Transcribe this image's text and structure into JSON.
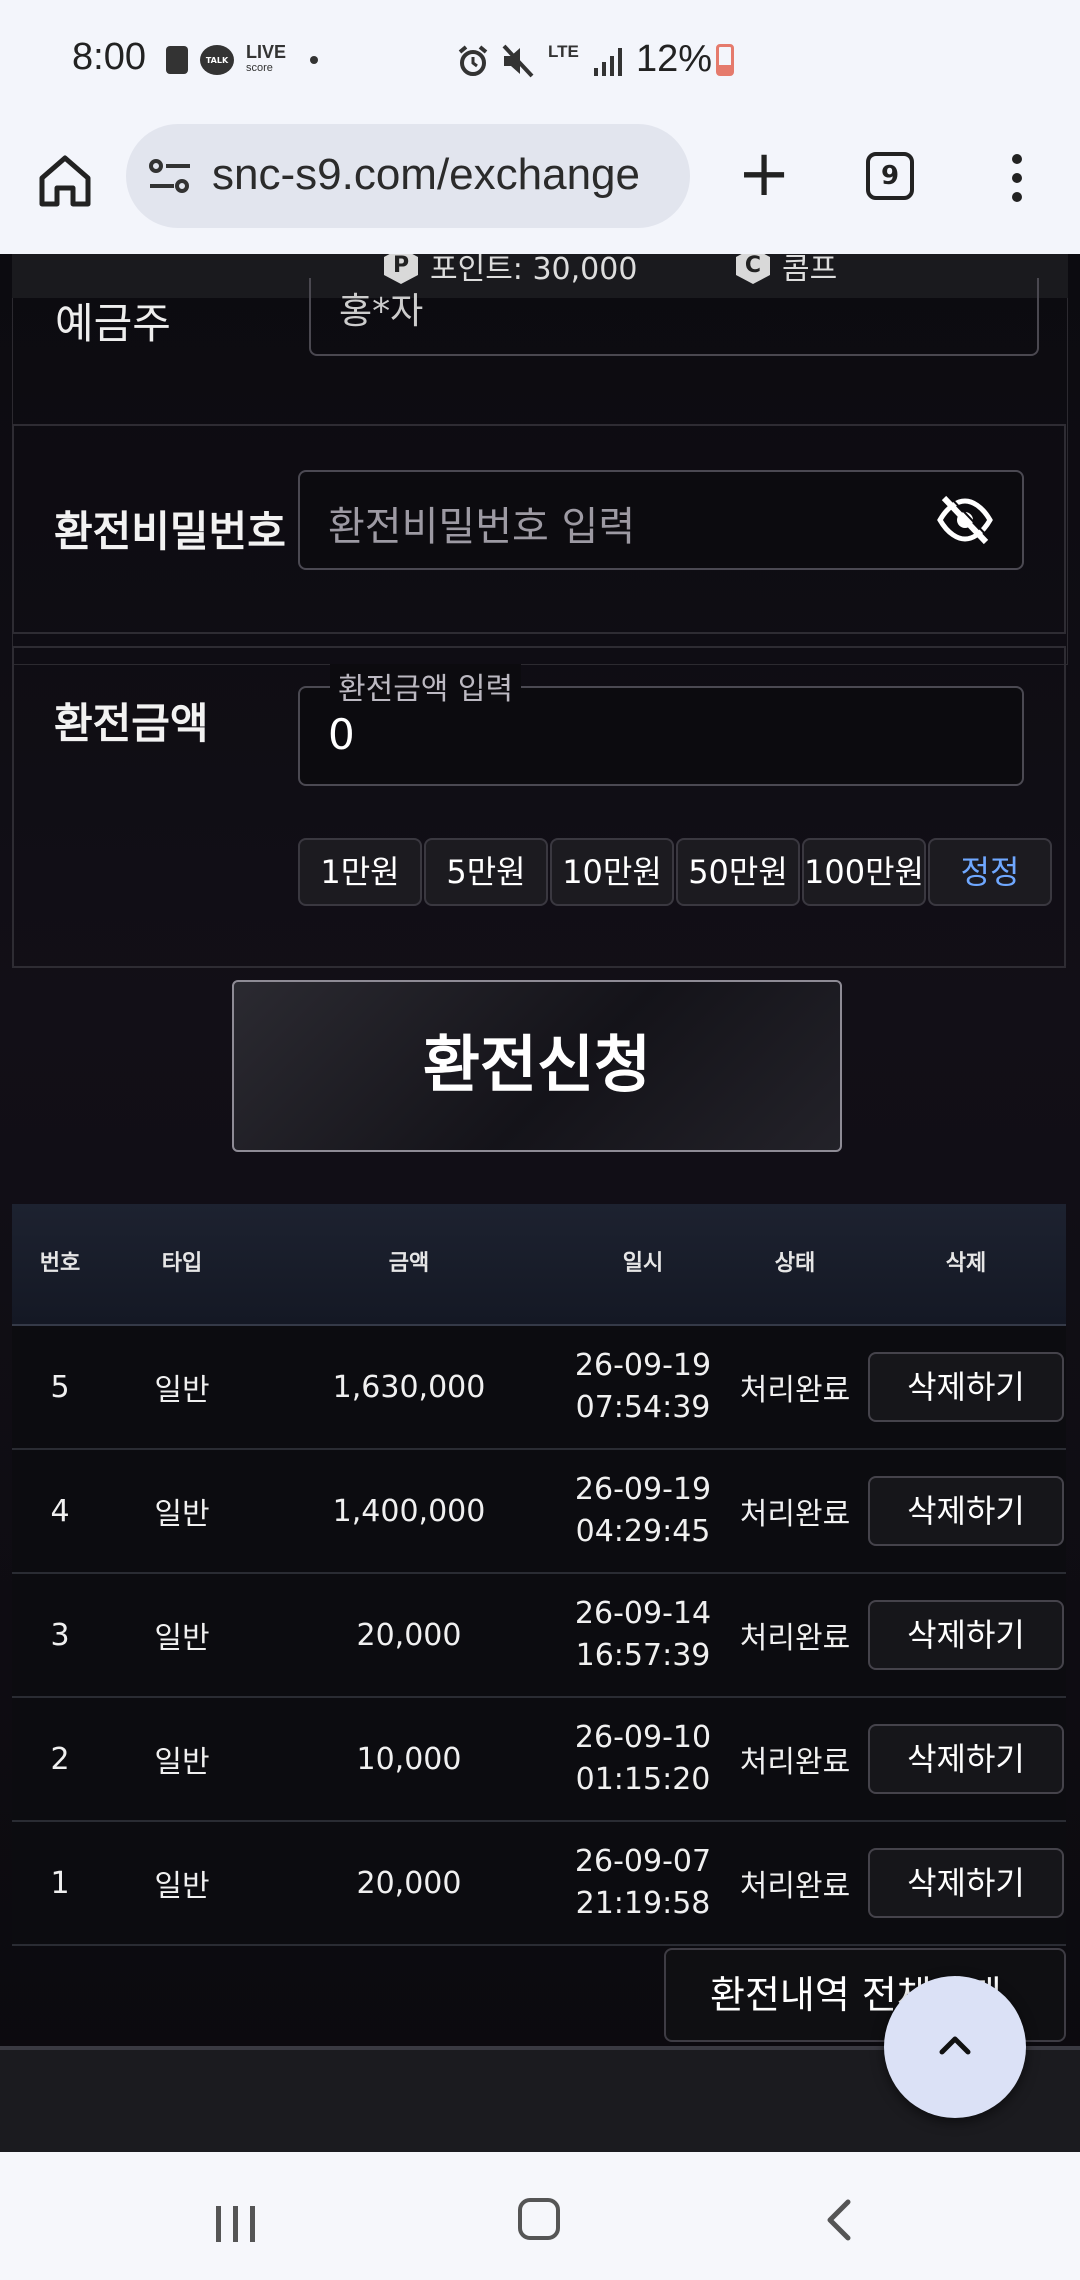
{
  "status_bar": {
    "time": "8:00",
    "left_icons": [
      "alert-icon",
      "talk-icon",
      "livescore-icon",
      "dot-icon"
    ],
    "talk_label": "TALK",
    "live_label": "LIVE",
    "live_sub": "score",
    "network": "LTE",
    "battery_pct": "12%",
    "right_icons": [
      "alarm-icon",
      "mute-icon",
      "lte-icon",
      "signal-icon",
      "battery-icon"
    ]
  },
  "browser": {
    "url": "snc-s9.com/exchange",
    "tab_count": "9"
  },
  "top_info": {
    "points_badge": "P",
    "points_text": "포인트: 30,000",
    "comp_badge": "C",
    "comp_text": "콤프"
  },
  "partial_row": {
    "label": "예금주",
    "value": "홍*자"
  },
  "password_row": {
    "label": "환전비밀번호",
    "placeholder": "환전비밀번호 입력"
  },
  "amount_row": {
    "label": "환전금액",
    "legend": "환전금액 입력",
    "value": "0",
    "chips": [
      "1만원",
      "5만원",
      "10만원",
      "50만원",
      "100만원"
    ],
    "reset_label": "정정"
  },
  "submit_label": "환전신청",
  "table": {
    "headers": [
      "번호",
      "타입",
      "금액",
      "일시",
      "상태",
      "삭제"
    ],
    "rows": [
      {
        "no": "5",
        "type": "일반",
        "amount": "1,630,000",
        "date": "26-09-19",
        "time": "07:54:39",
        "status": "처리완료",
        "action": "삭제하기"
      },
      {
        "no": "4",
        "type": "일반",
        "amount": "1,400,000",
        "date": "26-09-19",
        "time": "04:29:45",
        "status": "처리완료",
        "action": "삭제하기"
      },
      {
        "no": "3",
        "type": "일반",
        "amount": "20,000",
        "date": "26-09-14",
        "time": "16:57:39",
        "status": "처리완료",
        "action": "삭제하기"
      },
      {
        "no": "2",
        "type": "일반",
        "amount": "10,000",
        "date": "26-09-10",
        "time": "01:15:20",
        "status": "처리완료",
        "action": "삭제하기"
      },
      {
        "no": "1",
        "type": "일반",
        "amount": "20,000",
        "date": "26-09-07",
        "time": "21:19:58",
        "status": "처리완료",
        "action": "삭제하기"
      }
    ]
  },
  "delete_all_label": "환전내역 전체삭제"
}
